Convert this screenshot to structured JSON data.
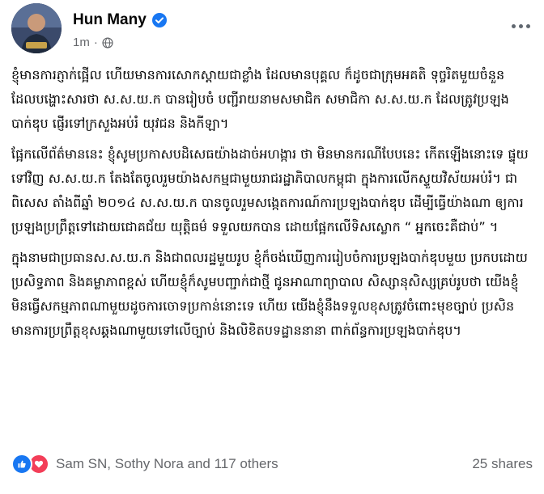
{
  "post": {
    "author": "Hun Many",
    "timestamp": "1m",
    "separator": "·",
    "paragraphs": [
      "ខ្ញុំមានការភ្ញាក់ផ្អើល ហើយមានការសោកស្តាយជាខ្លាំង ដែលមានបុគ្គល ក៏ដូចជាក្រុមអគតិ ទុច្ចរិតមួយចំនួន ដែលបង្ហោះសារថា ស.ស.យ.ក បានរៀបចំ បញ្ជីរាយនាមសមាជិក សមាជិកា ស.ស.យ.ក ដែលត្រូវប្រឡងបាក់ឌុប ផ្ញើរទៅក្រសួងអប់រំ យុវជន និងកីឡា។",
      "ផ្អែកលើព័ត៌មាននេះ ខ្ញុំសូមប្រកាសបដិសេធយ៉ាងដាច់អហង្ការ ថា មិនមានករណីបែបនេះ កើតឡើងនោះទេ ផ្ទុយទៅវិញ ស.ស.យ.ក តែងតែចូលរួមយ៉ាងសកម្មជាមួយរាជរដ្ឋាភិបាលកម្ពុជា ក្នុងការលើកស្ទួយវិស័យអប់រំ។ ជាពិសេស តាំងពីឆ្នាំ ២០១៤ ស.ស.យ.ក បានចូលរួមសង្កេតការណ៍ការប្រឡងបាក់ឌុប ដើម្បីធ្វើយ៉ាងណា ឲ្យការប្រឡងប្រព្រឹត្តទៅដោយជោគជ័យ យុត្តិធម៌ ទទួលយកបាន ដោយផ្អែកលើទិសស្លោក “ អ្នកចេះគឺជាប់” ។",
      "ក្នុងនាមជាប្រធានស.ស.យ.ក និងជាពលរដ្ឋមួយរូប ខ្ញុំក៏ចង់ឃើញការរៀបចំការប្រឡងបាក់ឌុបមួយ ប្រកបដោយប្រសិទ្ធភាព និងគម្លាភាពខ្ពស់ ហើយខ្ញុំក៏សូមបញ្ជាក់ជាថ្មី ជូនអាណាព្យាបាល សិស្សានុសិស្សគ្រប់រូបថា យើងខ្ញុំមិនធ្វើសកម្មភាពណាមួយដូចការចោទប្រកាន់នោះទេ ហើយ យើងខ្ញុំនឹងទទួលខុសត្រូវចំពោះមុខច្បាប់ ប្រសិនមានការប្រព្រឹត្តខុសឆ្គងណាមួយទៅលើច្បាប់ និងលិខិតបទដ្ឋាននានា ពាក់ព័ន្ធការប្រឡងបាក់ឌុប។"
    ]
  },
  "footer": {
    "reaction_names": "Sam SN, Sothy Nora and 117 others",
    "shares": "25 shares"
  },
  "icons": {
    "verified": "verified-badge-icon",
    "audience": "globe-icon",
    "more": "more-options-icon",
    "like": "like-reaction-icon",
    "love": "love-reaction-icon"
  },
  "colors": {
    "accent": "#1877f2",
    "love": "#f33e58",
    "secondary_text": "#65676b",
    "primary_text": "#050505"
  }
}
